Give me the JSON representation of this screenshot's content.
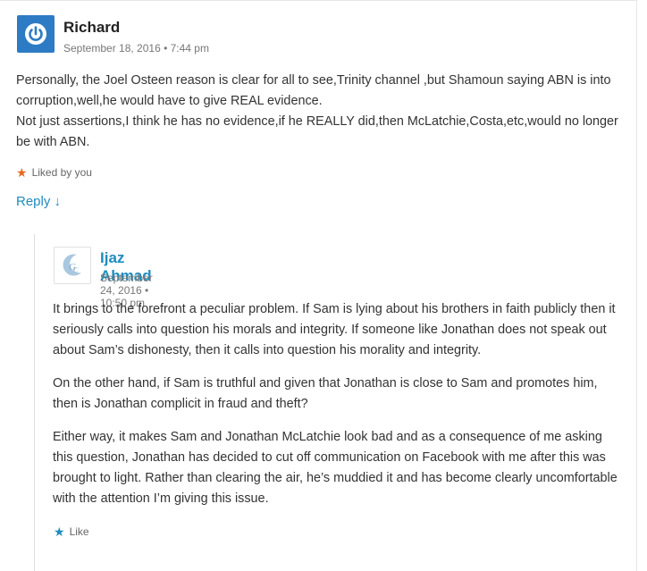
{
  "comments": [
    {
      "author": "Richard",
      "date": "September 18, 2016 • 7:44 pm",
      "paragraphs": [
        "Personally, the Joel Osteen reason is clear for all to see,Trinity channel ,but Shamoun saying ABN is into corruption,well,he would have to give REAL evidence.",
        "Not just assertions,I think he has no evidence,if he REALLY did,then McLatchie,Costa,etc,would no longer be with ABN."
      ],
      "like_text": "Liked by you",
      "reply_label": "Reply ↓",
      "avatar_icon": "power-icon",
      "avatar_color": "#2d7bc4"
    },
    {
      "author": "Ijaz Ahmad",
      "date": "September 24, 2016 • 10:50 pm",
      "paragraphs": [
        "It brings to the forefront a peculiar problem. If Sam is lying about his brothers in faith publicly then it seriously calls into question his morals and integrity. If someone like Jonathan does not speak out about Sam’s dishonesty, then it calls into question his morality and integrity.",
        "On the other hand, if Sam is truthful and given that Jonathan is close to Sam and promotes him, then is Jonathan complicit in fraud and theft?",
        "Either way, it makes Sam and Jonathan McLatchie look bad and as a consequence of me asking this question, Jonathan has decided to cut off communication on Facebook with me after this was brought to light. Rather than clearing the air, he’s muddied it and has become clearly uncomfortable with the attention I’m giving this issue."
      ],
      "like_text": "Like",
      "avatar_icon": "crescent-logo-icon",
      "link_color": "#1e8cbe"
    }
  ]
}
